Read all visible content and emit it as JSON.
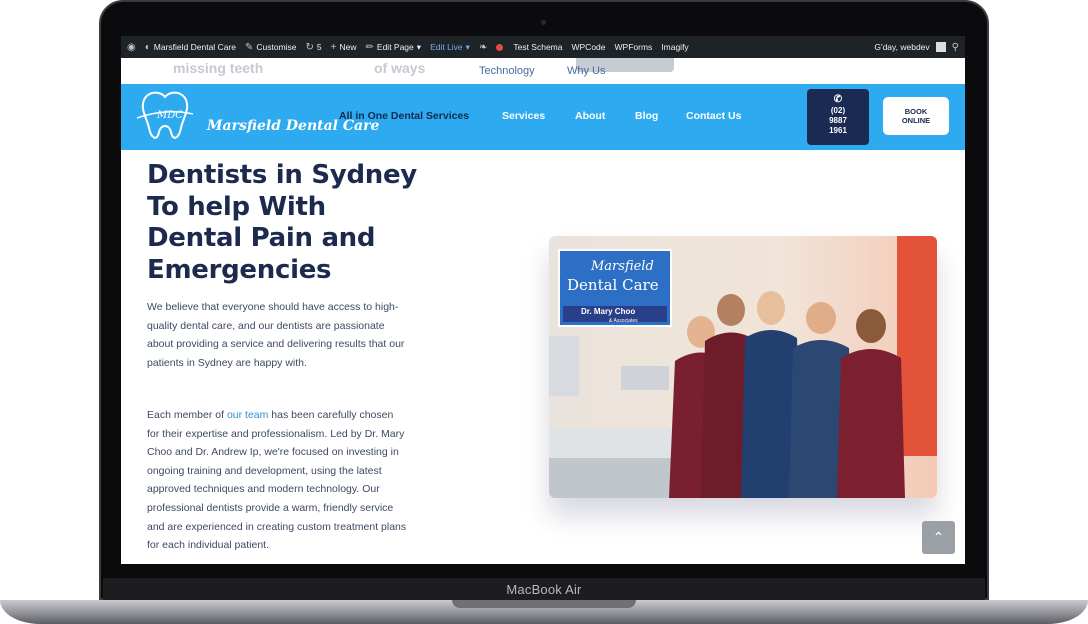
{
  "device": {
    "brand": "MacBook Air"
  },
  "admin_bar": {
    "site_name": "Marsfield Dental Care",
    "customise": "Customise",
    "updates": "5",
    "new": "New",
    "edit_page": "Edit Page",
    "edit_live": "Edit Live",
    "test_schema": "Test Schema",
    "wpcode": "WPCode",
    "wpforms": "WPForms",
    "imagify": "Imagify",
    "greeting": "G'day, webdev"
  },
  "ghost_header": {
    "left": "missing teeth",
    "mid": "of ways",
    "menu_technology": "Technology",
    "menu_why_us": "Why Us"
  },
  "header": {
    "logo_mark": "MDC",
    "logo_text": "Marsfield Dental Care",
    "tagline": "All in One Dental Services",
    "nav": [
      "Services",
      "About",
      "Blog",
      "Contact Us"
    ],
    "phone_lines": [
      "(02)",
      "9887",
      "1961"
    ],
    "book_lines": [
      "BOOK",
      "ONLINE"
    ]
  },
  "content": {
    "headline": "Dentists in Sydney To help With Dental Pain and Emergencies",
    "para1": "We believe that everyone should have access to high-quality dental care, and our dentists are passionate about providing a service and delivering results that our patients in Sydney are happy with.",
    "para2_before": "Each member of ",
    "para2_link": "our team",
    "para2_after": " has been carefully chosen for their expertise and professionalism. Led by Dr. Mary Choo and Dr. Andrew Ip, we're focused on investing in ongoing training and development, using the latest approved techniques and modern technology. Our professional dentists provide a warm, friendly service and are experienced in creating custom treatment plans for each individual patient."
  },
  "photo_sign": {
    "line1": "Marsfield",
    "line2": "Dental Care",
    "line3": "Dr. Mary Choo",
    "line4": "& Associates"
  },
  "colors": {
    "header_blue": "#2eaaf0",
    "navy": "#1b2a52",
    "heading": "#1c2b4d"
  }
}
